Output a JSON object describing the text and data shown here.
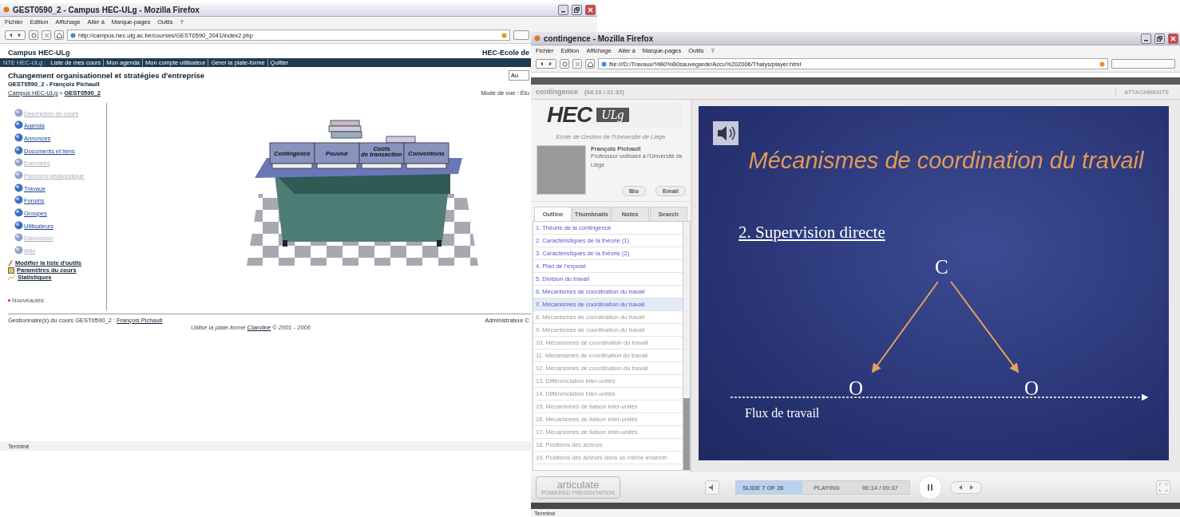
{
  "course_window": {
    "title": "GEST0590_2 - Campus HEC-ULg - Mozilla Firefox",
    "menu": [
      "Fichier",
      "Edition",
      "Affichage",
      "Aller à",
      "Marque-pages",
      "Outils",
      "?"
    ],
    "url": "http://campus.hec.ulg.ac.be/courses/GEST0590_2041/index2.php",
    "site_title": "Campus HEC-ULg",
    "site_right": "HEC-Ecole de",
    "nav_prefix": "NTE HEC-ULg :",
    "nav_links": [
      "Liste de mes cours",
      "Mon agenda",
      "Mon compte utilisateur",
      "Gérer la plate-forme",
      "Quitter"
    ],
    "search_field": "Ao",
    "course_title": "Changement organisationnel et stratégies d'entreprise",
    "course_subtitle": "GEST0590_2 - François Pichault",
    "breadcrumb": [
      "Campus HEC-ULg",
      "GEST0590_2"
    ],
    "breadcrumb_separator": ">",
    "view_mode": "Mode de vue : Étu",
    "tools": [
      {
        "label": "Description du cours",
        "disabled": true
      },
      {
        "label": "Agenda",
        "disabled": false
      },
      {
        "label": "Annonces",
        "disabled": false
      },
      {
        "label": "Documents et liens",
        "disabled": false
      },
      {
        "label": "Exercices",
        "disabled": true
      },
      {
        "label": "Parcours pédagogique",
        "disabled": true
      },
      {
        "label": "Travaux",
        "disabled": false
      },
      {
        "label": "Forums",
        "disabled": false
      },
      {
        "label": "Groupes",
        "disabled": false
      },
      {
        "label": "Utilisateurs",
        "disabled": false
      },
      {
        "label": "Discussion",
        "disabled": true
      },
      {
        "label": "Wiki",
        "disabled": true
      }
    ],
    "admin_links": [
      {
        "label": "Modifier la liste d'outils",
        "kind": "pencil"
      },
      {
        "label": "Paramètres du cours",
        "kind": "settings"
      },
      {
        "label": "Statistiques",
        "kind": "chart"
      }
    ],
    "legend": "Nouveautés",
    "books": [
      "Contingence",
      "Pouvoir",
      "Coûts de transaction",
      "Conventions"
    ],
    "footer_manager_label": "Gestionnaire(s) du cours GEST0590_2 :",
    "footer_manager_link": "François Pichault",
    "footer_admin": "Administrateur C",
    "footer_platform": "Utilise la plate-forme",
    "footer_platform_link": "Claroline",
    "footer_platform_end": "© 2001 - 2006",
    "status": "Terminé"
  },
  "player_window": {
    "title": "contingence - Mozilla Firefox",
    "menu": [
      "Fichier",
      "Edition",
      "Affichage",
      "Aller à",
      "Marque-pages",
      "Outils",
      "?"
    ],
    "url": "file:///D:/Travaux/%B0%B0sauvegarde/Accu%202006/Thalys/player.html",
    "presentation_title": "contingence",
    "presentation_time": "(04:10 / 21:32)",
    "attachments": "ATTACHMENTS",
    "logo_main": "HEC",
    "logo_badge": "ULg",
    "school": "Ecole de Gestion de l'Université de Liège",
    "presenter_name": "François Pichault",
    "presenter_role": "Professeur ordinaire à l'Université de Liège",
    "presenter_buttons": [
      "Bio",
      "Email"
    ],
    "tabs": [
      {
        "label": "Outline",
        "selected": true
      },
      {
        "label": "Thumbnails",
        "selected": false
      },
      {
        "label": "Notes",
        "selected": false
      },
      {
        "label": "Search",
        "selected": false
      }
    ],
    "outline": [
      {
        "label": "1. Théorie de la contingence",
        "viewed": true,
        "selected": false
      },
      {
        "label": "2. Caractéristiques de la théorie (1)",
        "viewed": true,
        "selected": false
      },
      {
        "label": "3. Caractéristiques de la théorie (2)",
        "viewed": true,
        "selected": false
      },
      {
        "label": "4. Plan de l'exposé",
        "viewed": true,
        "selected": false
      },
      {
        "label": "5. Division du travail",
        "viewed": true,
        "selected": false
      },
      {
        "label": "6. Mécanismes de coordination du travail",
        "viewed": true,
        "selected": false
      },
      {
        "label": "7. Mécanismes de coordination du travail",
        "viewed": true,
        "selected": true
      },
      {
        "label": "8. Mécanismes de coordination du travail",
        "viewed": false,
        "selected": false
      },
      {
        "label": "9. Mécanismes de coordination du travail",
        "viewed": false,
        "selected": false
      },
      {
        "label": "10. Mécanismes de coordination du travail",
        "viewed": false,
        "selected": false
      },
      {
        "label": "11. Mécanismes de coordination du travail",
        "viewed": false,
        "selected": false
      },
      {
        "label": "12. Mécanismes de coordination du travail",
        "viewed": false,
        "selected": false
      },
      {
        "label": "13. Différenciation inter-unités",
        "viewed": false,
        "selected": false
      },
      {
        "label": "14. Différenciation inter-unités",
        "viewed": false,
        "selected": false
      },
      {
        "label": "15. Mécanismes de liaison inter-unités",
        "viewed": false,
        "selected": false
      },
      {
        "label": "16. Mécanismes de liaison inter-unités",
        "viewed": false,
        "selected": false
      },
      {
        "label": "17. Mécanismes de liaison inter-unités",
        "viewed": false,
        "selected": false
      },
      {
        "label": "18. Positions des acteurs",
        "viewed": false,
        "selected": false
      },
      {
        "label": "19. Positions des acteurs dans un même ensemb",
        "viewed": false,
        "selected": false
      }
    ],
    "slide": {
      "title": "Mécanismes de coordination du travail",
      "subtitle": "2. Supervision directe",
      "top_node": "C",
      "bottom_nodes": [
        "O",
        "O"
      ],
      "flow_label": "Flux de travail"
    },
    "brand": "articulate",
    "brand_sub": "POWERED PRESENTATION",
    "slide_counter": "SLIDE 7 OF 28",
    "play_state": "PLAYING",
    "play_time": "00:14 / 00:37",
    "status": "Terminé"
  }
}
